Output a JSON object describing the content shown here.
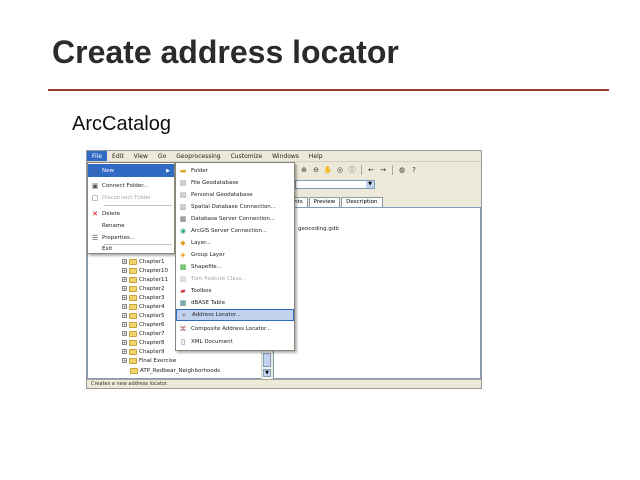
{
  "slide": {
    "title": "Create address locator",
    "subtitle": "ArcCatalog"
  },
  "app": {
    "menubar": [
      "File",
      "Edit",
      "View",
      "Go",
      "Geoprocessing",
      "Customize",
      "Windows",
      "Help"
    ],
    "toolbar_icons": [
      "zoom-in-icon",
      "zoom-out-icon",
      "pan-icon",
      "full-extent-icon",
      "identify-icon",
      "back-icon",
      "forward-icon",
      "globe-icon",
      "help-icon"
    ],
    "file_menu": [
      {
        "label": "New",
        "icon": "new-icon",
        "submenu": true,
        "highlighted": true
      },
      {
        "label": "Connect Folder...",
        "icon": "connect-folder-icon"
      },
      {
        "label": "Disconnect Folder",
        "icon": "disconnect-folder-icon",
        "disabled": true
      },
      {
        "label": "Delete",
        "icon": "delete-icon"
      },
      {
        "label": "Rename",
        "icon": ""
      },
      {
        "label": "Properties...",
        "icon": "properties-icon"
      },
      {
        "label": "Exit",
        "icon": ""
      }
    ],
    "new_menu": [
      {
        "label": "Folder",
        "icon": "folder-icon"
      },
      {
        "label": "File Geodatabase",
        "icon": "file-geodatabase-icon"
      },
      {
        "label": "Personal Geodatabase",
        "icon": "personal-geodatabase-icon"
      },
      {
        "label": "Spatial Database Connection...",
        "icon": "database-connection-icon"
      },
      {
        "label": "Database Server Connection...",
        "icon": "server-connection-icon"
      },
      {
        "label": "ArcGIS Server Connection...",
        "icon": "arcgis-server-icon"
      },
      {
        "label": "Layer...",
        "icon": "layer-icon"
      },
      {
        "label": "Group Layer",
        "icon": "group-layer-icon"
      },
      {
        "label": "Shapefile...",
        "icon": "shapefile-icon"
      },
      {
        "label": "Turn Feature Class...",
        "icon": "turn-feature-class-icon",
        "disabled": true
      },
      {
        "label": "Toolbox",
        "icon": "toolbox-icon"
      },
      {
        "label": "dBASE Table",
        "icon": "dbase-table-icon"
      },
      {
        "label": "Address Locator...",
        "icon": "address-locator-icon",
        "highlighted": true
      },
      {
        "label": "Composite Address Locator...",
        "icon": "composite-locator-icon"
      },
      {
        "label": "XML Document",
        "icon": "xml-document-icon"
      }
    ],
    "tabs": [
      "Contents",
      "Preview",
      "Description"
    ],
    "content_entry": "geocoding.gdb",
    "tree_items": [
      "Chapter1",
      "Chapter10",
      "Chapter11",
      "Chapter2",
      "Chapter3",
      "Chapter4",
      "Chapter5",
      "Chapter6",
      "Chapter7",
      "Chapter8",
      "Chapter9",
      "Final Exercise",
      "ATP_Redbear_Neighborhoods"
    ],
    "status_text": "Creates a new address locator."
  }
}
